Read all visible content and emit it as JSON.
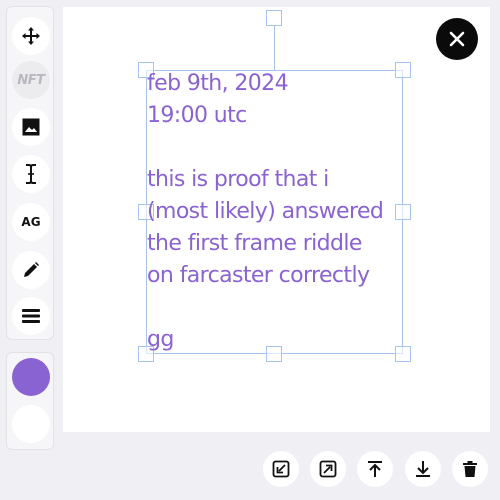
{
  "toolbar": {
    "items": [
      {
        "name": "move",
        "icon": "move-icon"
      },
      {
        "name": "nft",
        "icon": "nft-badge",
        "label": "NFT"
      },
      {
        "name": "image",
        "icon": "image-icon"
      },
      {
        "name": "text",
        "icon": "text-cursor-icon"
      },
      {
        "name": "font",
        "icon": "font-icon",
        "label": "AG"
      },
      {
        "name": "pen",
        "icon": "pen-icon"
      },
      {
        "name": "menu",
        "icon": "menu-icon"
      }
    ]
  },
  "colors": {
    "primary": "#8a63d2",
    "secondary": "#ffffff"
  },
  "canvas": {
    "text_lines": [
      "feb 9th, 2024",
      "19:00 utc",
      "",
      "this is proof that i",
      "(most likely) answered",
      "the first frame riddle",
      "on farcaster correctly",
      "",
      "gg"
    ]
  },
  "bottom_actions": [
    {
      "name": "shrink",
      "icon": "shrink-icon"
    },
    {
      "name": "expand",
      "icon": "expand-icon"
    },
    {
      "name": "bring-to-front",
      "icon": "bring-to-front-icon"
    },
    {
      "name": "send-to-back",
      "icon": "send-to-back-icon"
    },
    {
      "name": "delete",
      "icon": "trash-icon"
    }
  ]
}
